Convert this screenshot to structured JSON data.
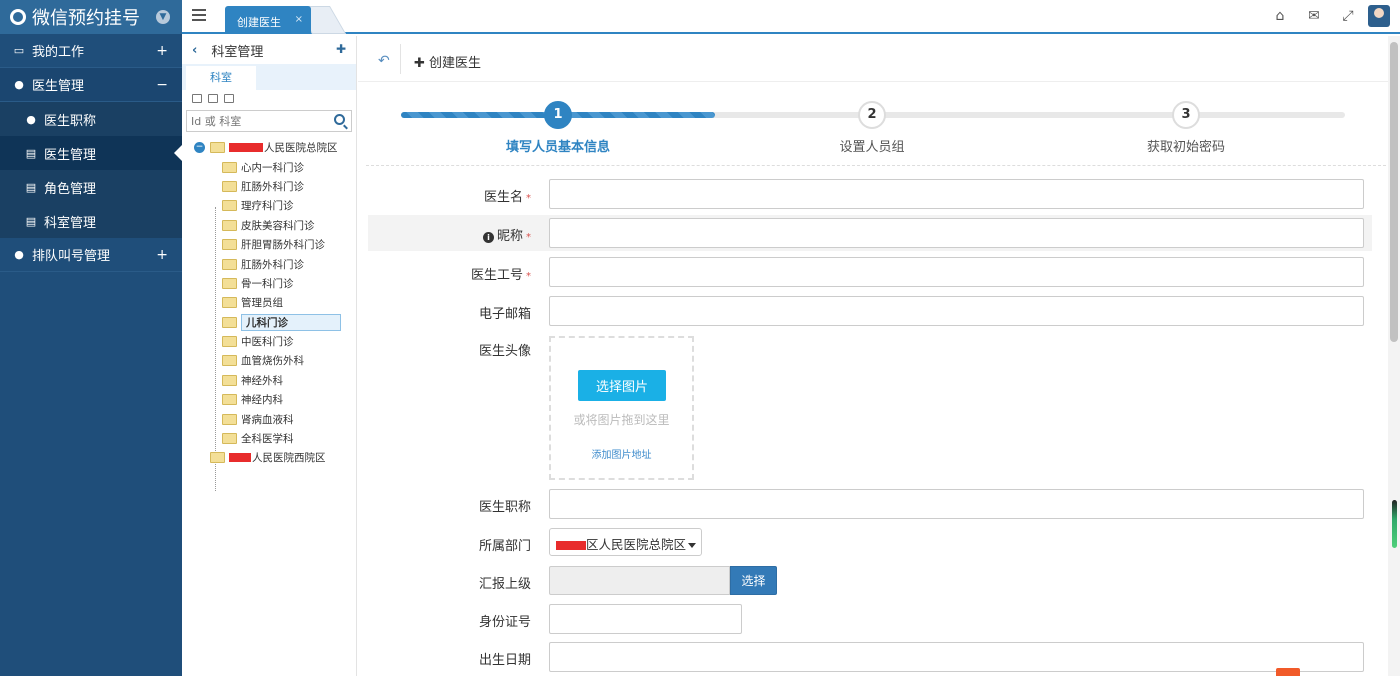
{
  "app": {
    "title": "微信预约挂号"
  },
  "sidebar": {
    "items": [
      {
        "label": "我的工作",
        "toggle": "+"
      },
      {
        "label": "医生管理",
        "toggle": "−"
      },
      {
        "label": "医生职称"
      },
      {
        "label": "医生管理"
      },
      {
        "label": "角色管理"
      },
      {
        "label": "科室管理"
      },
      {
        "label": "排队叫号管理",
        "toggle": "+"
      }
    ]
  },
  "topbar": {
    "tab_label": "创建医生",
    "tab_close": "×",
    "icons": [
      "home-icon",
      "chat-icon",
      "fullscreen-icon"
    ]
  },
  "tree": {
    "title": "科室管理",
    "tab_label": "科室",
    "search_placeholder": "Id 或 科室",
    "root1_label": "人民医院总院区",
    "root2_label": "人民医院西院区",
    "children": [
      "心内一科门诊",
      "肛肠外科门诊",
      "理疗科门诊",
      "皮肤美容科门诊",
      "肝胆胃肠外科门诊",
      "肛肠外科门诊",
      "骨一科门诊",
      "管理员组",
      "儿科门诊",
      "中医科门诊",
      "血管烧伤外科",
      "神经外科",
      "神经内科",
      "肾病血液科",
      "全科医学科"
    ],
    "selected_index": 8
  },
  "main": {
    "title": "创建医生",
    "steps": [
      {
        "num": "1",
        "label": "填写人员基本信息",
        "done": true
      },
      {
        "num": "2",
        "label": "设置人员组",
        "done": false
      },
      {
        "num": "3",
        "label": "获取初始密码",
        "done": false
      }
    ],
    "form": {
      "name_label": "医生名",
      "nickname_label": "昵称",
      "staff_no_label": "医生工号",
      "email_label": "电子邮箱",
      "avatar_label": "医生头像",
      "pick_button": "选择图片",
      "drag_hint": "或将图片拖到这里",
      "add_url": "添加图片地址",
      "title_label": "医生职称",
      "dept_label": "所属部门",
      "dept_value": "区人民医院总院区",
      "report_label": "汇报上级",
      "report_button": "选择",
      "id_label": "身份证号",
      "birth_label": "出生日期",
      "required_mark": "*"
    }
  },
  "colors": {
    "sidebar": "#1f4e7a",
    "accent": "#2f84c2",
    "pick_button": "#1ab0e6"
  }
}
